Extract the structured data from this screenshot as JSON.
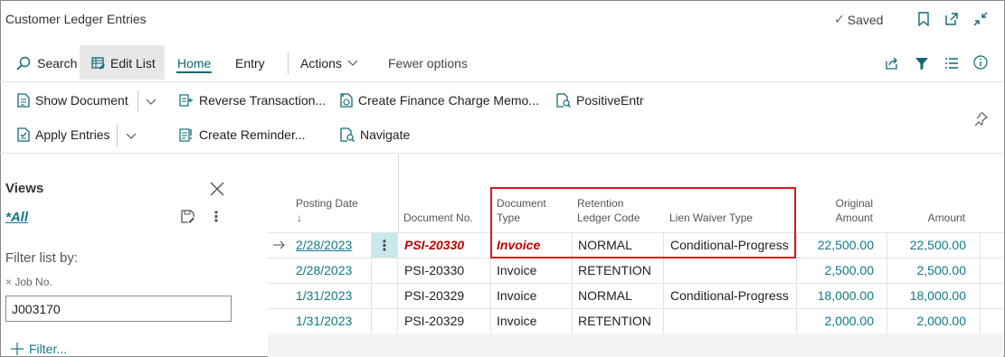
{
  "window": {
    "title": "Customer Ledger Entries",
    "saved_label": "Saved"
  },
  "menu": {
    "search_label": "Search",
    "edit_list_label": "Edit List",
    "home_label": "Home",
    "entry_label": "Entry",
    "actions_label": "Actions",
    "fewer_options_label": "Fewer options"
  },
  "actions": {
    "show_document": "Show Document",
    "reverse_transaction": "Reverse Transaction...",
    "create_finance_charge_memo": "Create Finance Charge Memo...",
    "positive_entr": "PositiveEntr",
    "apply_entries": "Apply Entries",
    "create_reminder": "Create Reminder...",
    "navigate": "Navigate"
  },
  "views_pane": {
    "title": "Views",
    "all_view": "*All",
    "filter_list_by": "Filter list by:",
    "filter_field_label": "Job No.",
    "filter_field_value": "J003170",
    "add_filter_label": "Filter..."
  },
  "grid": {
    "headers": {
      "posting_date": "Posting Date",
      "posting_date_sort": "↓",
      "document_no": "Document No.",
      "document_type_1": "Document",
      "document_type_2": "Type",
      "retention_code_1": "Retention",
      "retention_code_2": "Ledger Code",
      "lien_waiver_type": "Lien Waiver Type",
      "original_amount_1": "Original",
      "original_amount_2": "Amount",
      "amount": "Amount"
    },
    "rows": [
      {
        "posting_date": "2/28/2023",
        "document_no": "PSI-20330",
        "document_type": "Invoice",
        "retention_code": "NORMAL",
        "lien_waiver_type": "Conditional-Progress",
        "original_amount": "22,500.00",
        "amount": "22,500.00"
      },
      {
        "posting_date": "2/28/2023",
        "document_no": "PSI-20330",
        "document_type": "Invoice",
        "retention_code": "RETENTION",
        "lien_waiver_type": "",
        "original_amount": "2,500.00",
        "amount": "2,500.00"
      },
      {
        "posting_date": "1/31/2023",
        "document_no": "PSI-20329",
        "document_type": "Invoice",
        "retention_code": "NORMAL",
        "lien_waiver_type": "Conditional-Progress",
        "original_amount": "18,000.00",
        "amount": "18,000.00"
      },
      {
        "posting_date": "1/31/2023",
        "document_no": "PSI-20329",
        "document_type": "Invoice",
        "retention_code": "RETENTION",
        "lien_waiver_type": "",
        "original_amount": "2,000.00",
        "amount": "2,000.00"
      }
    ]
  },
  "colors": {
    "accent": "#0f7a86",
    "highlight_border": "#e0161b",
    "selected_text": "#c00000"
  }
}
